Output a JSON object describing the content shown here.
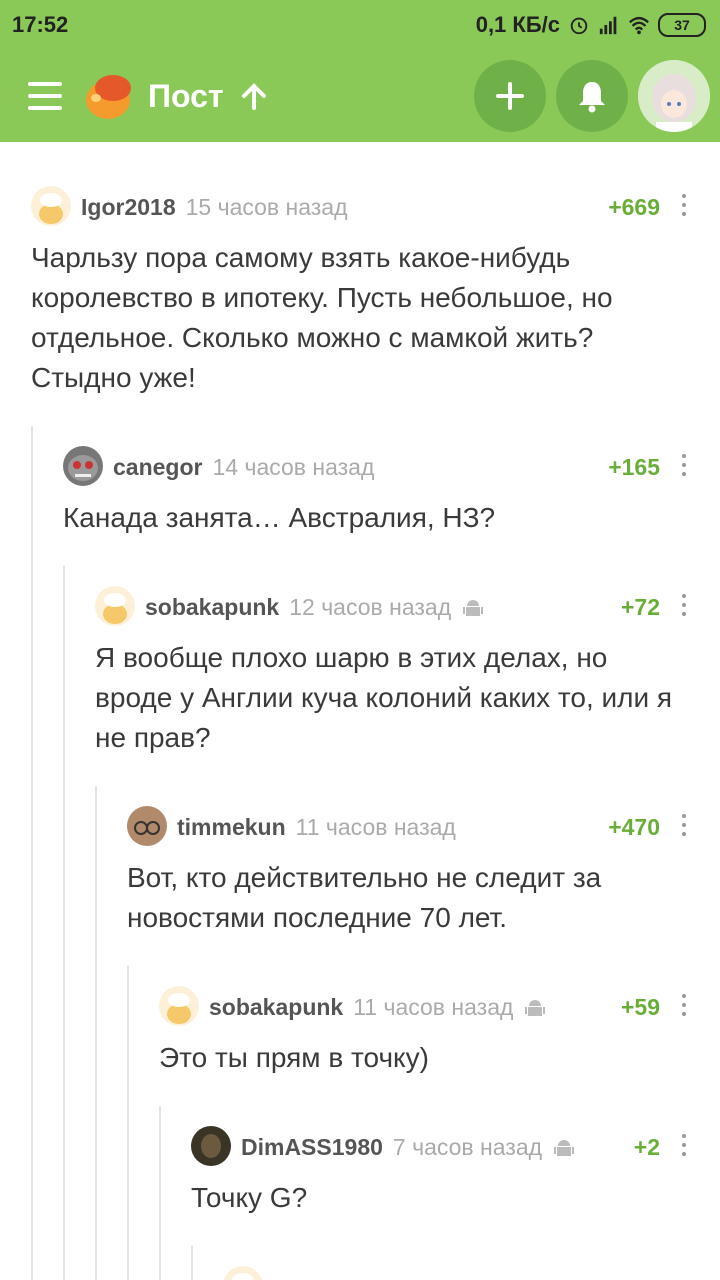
{
  "status": {
    "time": "17:52",
    "speed": "0,1 КБ/с",
    "battery": "37"
  },
  "appbar": {
    "title": "Пост"
  },
  "comments": [
    {
      "user": "Igor2018",
      "time": "15 часов назад",
      "rating": "+669",
      "android": false,
      "text": "Чарльзу пора самому взять какое-нибудь королевство в ипотеку. Пусть небольшое, но отдельное. Сколько можно с мамкой жить? Стыдно уже!"
    },
    {
      "user": "canegor",
      "time": "14 часов назад",
      "rating": "+165",
      "android": false,
      "text": "Канада занята… Австралия, НЗ?"
    },
    {
      "user": "sobakapunk",
      "time": "12 часов назад",
      "rating": "+72",
      "android": true,
      "text": "Я вообще плохо шарю в этих делах, но вроде у Англии куча колоний каких то, или я не прав?"
    },
    {
      "user": "timmekun",
      "time": "11 часов назад",
      "rating": "+470",
      "android": false,
      "text": "Вот, кто действительно не следит за новостями последние 70 лет."
    },
    {
      "user": "sobakapunk",
      "time": "11 часов назад",
      "rating": "+59",
      "android": true,
      "text": "Это ты прям в точку)"
    },
    {
      "user": "DimASS1980",
      "time": "7 часов назад",
      "rating": "+2",
      "android": true,
      "text": "Точку G?"
    }
  ]
}
